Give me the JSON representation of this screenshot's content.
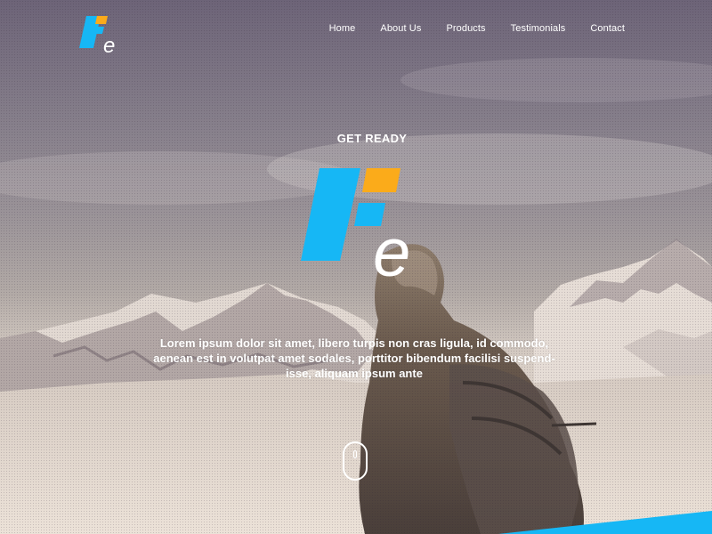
{
  "colors": {
    "brand_blue": "#16b7f5",
    "brand_orange": "#fbab1a",
    "text": "#ffffff"
  },
  "logo": {
    "letter": "e"
  },
  "nav": {
    "items": [
      {
        "label": "Home"
      },
      {
        "label": "About Us"
      },
      {
        "label": "Products"
      },
      {
        "label": "Testimonials"
      },
      {
        "label": "Contact"
      }
    ]
  },
  "hero": {
    "kicker": "GET READY",
    "lead": "Lorem ipsum dolor sit amet, libero turpis non cras ligula, id commodo, aenean est in volutpat amet sodales, porttitor bibendum facilisi suspend-isse, aliquam ipsum ante"
  },
  "icons": {
    "scroll": "mouse-scroll-icon"
  }
}
